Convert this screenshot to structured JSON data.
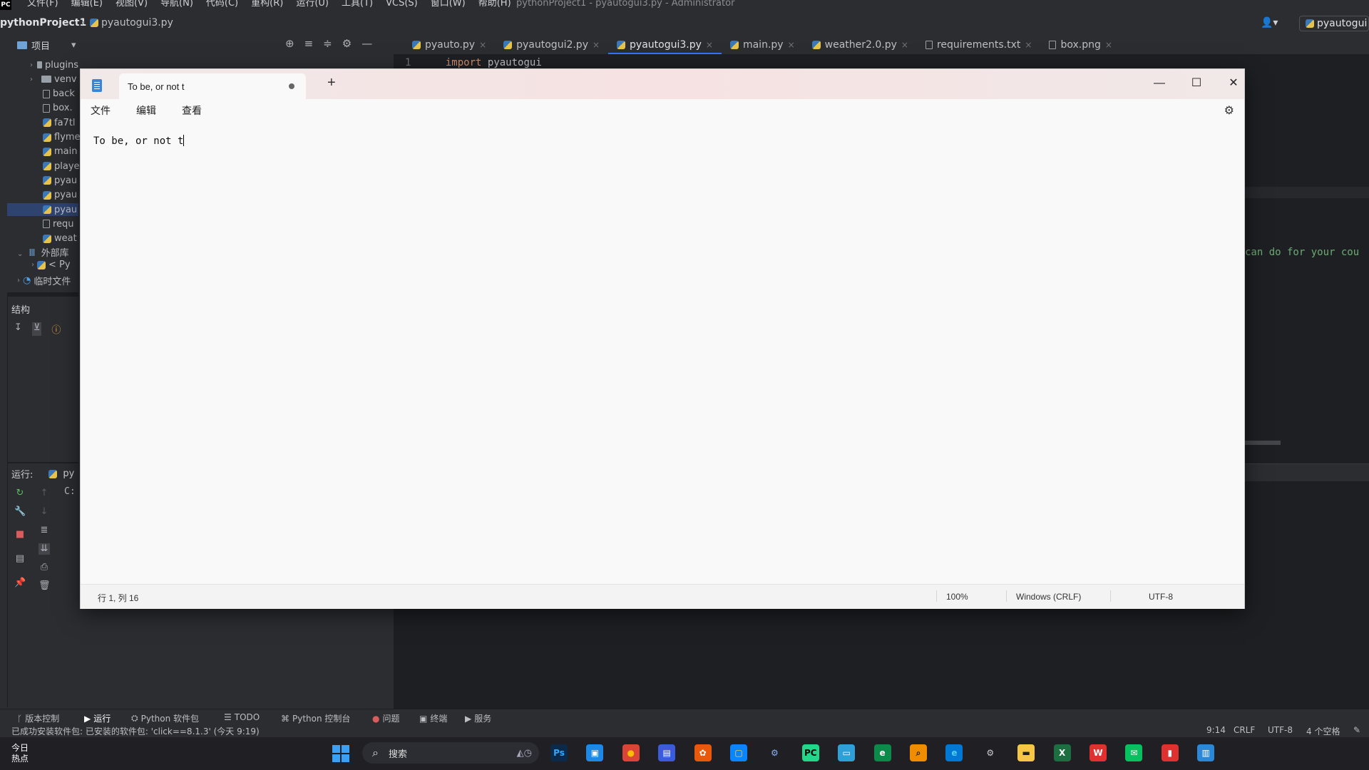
{
  "ide": {
    "menu": [
      "文件(F)",
      "编辑(E)",
      "视图(V)",
      "导航(N)",
      "代码(C)",
      "重构(R)",
      "运行(U)",
      "工具(T)",
      "VCS(S)",
      "窗口(W)",
      "帮助(H)"
    ],
    "window_title": "pythonProject1 - pyautogui3.py - Administrator",
    "logo_text": "PC",
    "project_name": "pythonProject1",
    "crumb_file": "pyautogui3.py",
    "run_config": "pyautogui",
    "project_header": "项目",
    "tree": [
      {
        "label": "plugins",
        "type": "folder",
        "chevron": "›"
      },
      {
        "label": "venv",
        "type": "folder",
        "chevron": "›"
      },
      {
        "label": "back",
        "type": "file"
      },
      {
        "label": "box.",
        "type": "file"
      },
      {
        "label": "fa7tl",
        "type": "py"
      },
      {
        "label": "flyme",
        "type": "py"
      },
      {
        "label": "main",
        "type": "py"
      },
      {
        "label": "playe",
        "type": "py"
      },
      {
        "label": "pyau",
        "type": "py"
      },
      {
        "label": "pyau",
        "type": "py"
      },
      {
        "label": "pyau",
        "type": "py",
        "selected": true
      },
      {
        "label": "requ",
        "type": "file"
      },
      {
        "label": "weat",
        "type": "py"
      }
    ],
    "external_libs": "外部库",
    "python_sdk": "< Py",
    "scratches": "临时文件",
    "structure_header": "结构",
    "run_header": "运行:",
    "run_tab": "py",
    "run_output": "C:",
    "tabs": [
      {
        "label": "pyauto.py",
        "type": "py"
      },
      {
        "label": "pyautogui2.py",
        "type": "py"
      },
      {
        "label": "pyautogui3.py",
        "type": "py",
        "active": true
      },
      {
        "label": "main.py",
        "type": "py"
      },
      {
        "label": "weather2.0.py",
        "type": "py"
      },
      {
        "label": "requirements.txt",
        "type": "txt"
      },
      {
        "label": "box.png",
        "type": "img"
      }
    ],
    "code": {
      "line_no": "1",
      "keyword": "import",
      "module": "pyautogui"
    },
    "code_comment_fragment": "can do for your cou",
    "bottom_tools": [
      "版本控制",
      "运行",
      "Python 软件包",
      "TODO",
      "Python 控制台",
      "问题",
      "终端",
      "服务"
    ],
    "status_message": "已成功安装软件包: 已安装的软件包: 'click==8.1.3' (今天 9:19)",
    "status_right": [
      "9:14",
      "CRLF",
      "UTF-8",
      "4 个空格"
    ]
  },
  "notepad": {
    "tab_title": "To be, or not t",
    "menu": [
      "文件",
      "编辑",
      "查看"
    ],
    "content": "To be, or not t",
    "status": {
      "position": "行 1, 列 16",
      "zoom": "100%",
      "line_ending": "Windows (CRLF)",
      "encoding": "UTF-8"
    }
  },
  "taskbar": {
    "news_line1": "今日",
    "news_line2": "热点",
    "search_placeholder": "搜索",
    "apps": [
      {
        "label": "Ps",
        "color": "#0b2a4a",
        "fg": "#31a8ff"
      },
      {
        "label": "▣",
        "color": "#1e88e5",
        "fg": "#ffffff"
      },
      {
        "label": "●",
        "color": "#db4437",
        "fg": "#fbbc05"
      },
      {
        "label": "▤",
        "color": "#3b5bdb",
        "fg": "#ffffff"
      },
      {
        "label": "✿",
        "color": "#e8590c",
        "fg": "#ffffff"
      },
      {
        "label": "▢",
        "color": "#0a84ff",
        "fg": "#ffd43b"
      },
      {
        "label": "⚙",
        "color": "#1f1f24",
        "fg": "#8ab4f8"
      },
      {
        "label": "PC",
        "color": "#21d789",
        "fg": "#000000"
      },
      {
        "label": "▭",
        "color": "#2f9fd8",
        "fg": "#ffffff"
      },
      {
        "label": "e",
        "color": "#0c8a4a",
        "fg": "#ffffff"
      },
      {
        "label": "⌕",
        "color": "#f08c00",
        "fg": "#1f1f24"
      },
      {
        "label": "e",
        "color": "#0078d4",
        "fg": "#56ccf2"
      },
      {
        "label": "⚙",
        "color": "#1f1f24",
        "fg": "#cccccc"
      },
      {
        "label": "▬",
        "color": "#f6c744",
        "fg": "#1f1f24"
      },
      {
        "label": "X",
        "color": "#1d6f42",
        "fg": "#ffffff"
      },
      {
        "label": "W",
        "color": "#e03131",
        "fg": "#ffffff"
      },
      {
        "label": "✉",
        "color": "#07c160",
        "fg": "#ffffff"
      },
      {
        "label": "▮",
        "color": "#e03131",
        "fg": "#ffffff"
      },
      {
        "label": "▥",
        "color": "#2b88d8",
        "fg": "#ffffff"
      }
    ]
  },
  "colors": {
    "accent": "#3574f0",
    "ide_bg": "#2b2d30",
    "editor_bg": "#1e1f22",
    "notepad_bg": "#f9f9f9"
  }
}
